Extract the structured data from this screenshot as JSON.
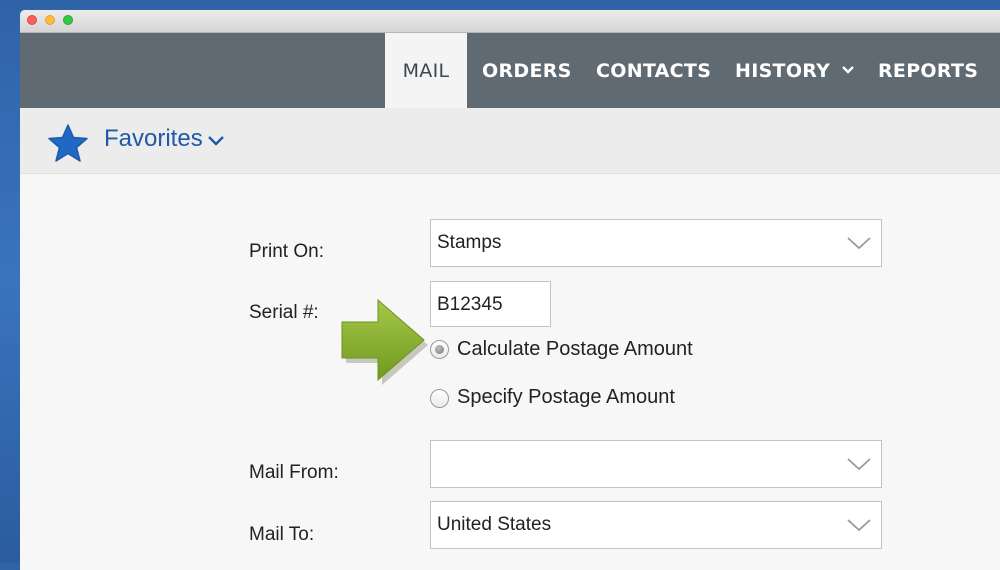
{
  "nav": {
    "tabs": [
      {
        "label": "MAIL",
        "active": true
      },
      {
        "label": "ORDERS"
      },
      {
        "label": "CONTACTS"
      },
      {
        "label": "HISTORY",
        "dropdown": true
      },
      {
        "label": "REPORTS"
      }
    ]
  },
  "favorites": {
    "label": "Favorites",
    "icon": "star-icon",
    "color": "#1f5aa8"
  },
  "form": {
    "print_on": {
      "label": "Print On:",
      "value": "Stamps"
    },
    "serial": {
      "label": "Serial #:",
      "value": "B12345"
    },
    "postage_options": [
      {
        "label": "Calculate Postage Amount",
        "checked": true
      },
      {
        "label": "Specify Postage Amount",
        "checked": false
      }
    ],
    "mail_from": {
      "label": "Mail From:",
      "value": ""
    },
    "mail_to": {
      "label": "Mail To:",
      "value": "United States"
    }
  },
  "annotation": {
    "icon": "green-arrow-icon",
    "color": "#8cb82e"
  }
}
